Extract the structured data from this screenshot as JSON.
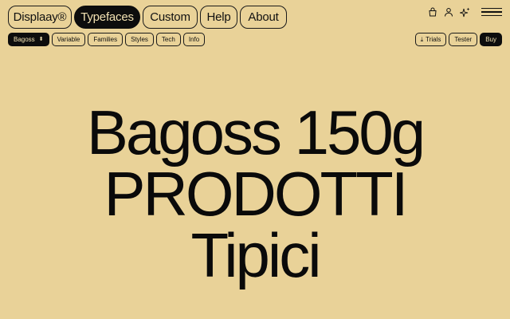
{
  "nav": {
    "brand": "Displaay®",
    "items": [
      {
        "label": "Typefaces",
        "active": true
      },
      {
        "label": "Custom",
        "active": false
      },
      {
        "label": "Help",
        "active": false
      },
      {
        "label": "About",
        "active": false
      }
    ]
  },
  "icons": [
    "bag-icon",
    "user-icon",
    "sparkle-icon",
    "menu-icon"
  ],
  "subnav": {
    "font_select": "Bagoss",
    "tabs": [
      "Variable",
      "Families",
      "Styles",
      "Tech",
      "Info"
    ],
    "right": {
      "trials": "Trials",
      "tester": "Tester",
      "buy": "Buy"
    }
  },
  "hero": {
    "line1": "Bagoss 150g",
    "line2": "PRODOTTI",
    "line3": "Tipici"
  },
  "colors": {
    "background": "#e9d298",
    "ink": "#0d0d0d",
    "active_text": "#f3e2b3"
  }
}
